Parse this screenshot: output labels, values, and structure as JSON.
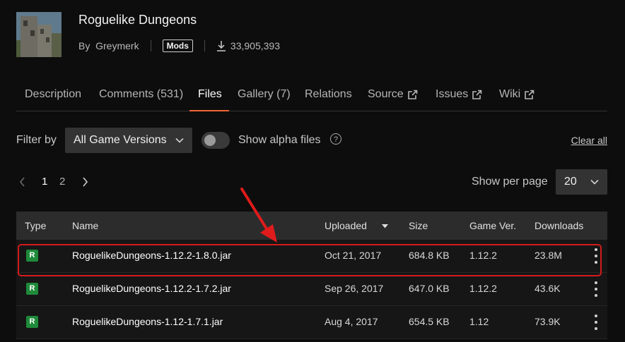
{
  "project": {
    "title": "Roguelike Dungeons",
    "author_prefix": "By",
    "author": "Greymerk",
    "category_badge": "Mods",
    "downloads": "33,905,393",
    "thumbnail_icon": "mod-thumbnail-icon"
  },
  "tabs": [
    {
      "label": "Description",
      "external": false
    },
    {
      "label": "Comments (531)",
      "external": false
    },
    {
      "label": "Files",
      "external": false,
      "active": true
    },
    {
      "label": "Gallery (7)",
      "external": false
    },
    {
      "label": "Relations",
      "external": false
    },
    {
      "label": "Source",
      "external": true
    },
    {
      "label": "Issues",
      "external": true
    },
    {
      "label": "Wiki",
      "external": true
    }
  ],
  "filters": {
    "filter_label": "Filter by",
    "game_version_selected": "All Game Versions",
    "alpha_toggle_label": "Show alpha files",
    "alpha_toggle_on": false,
    "clear_all": "Clear all"
  },
  "pagination": {
    "pages": [
      "1",
      "2"
    ],
    "current": "1",
    "per_page_label": "Show per page",
    "per_page_value": "20"
  },
  "table": {
    "columns": {
      "type": "Type",
      "name": "Name",
      "uploaded": "Uploaded",
      "size": "Size",
      "game_ver": "Game Ver.",
      "downloads": "Downloads"
    },
    "rows": [
      {
        "type": "R",
        "name": "RoguelikeDungeons-1.12.2-1.8.0.jar",
        "uploaded": "Oct 21, 2017",
        "size": "684.8 KB",
        "game_ver": "1.12.2",
        "downloads": "23.8M"
      },
      {
        "type": "R",
        "name": "RoguelikeDungeons-1.12.2-1.7.2.jar",
        "uploaded": "Sep 26, 2017",
        "size": "647.0 KB",
        "game_ver": "1.12.2",
        "downloads": "43.6K"
      },
      {
        "type": "R",
        "name": "RoguelikeDungeons-1.12-1.7.1.jar",
        "uploaded": "Aug 4, 2017",
        "size": "654.5 KB",
        "game_ver": "1.12",
        "downloads": "73.9K"
      }
    ]
  },
  "colors": {
    "accent": "#f16436",
    "release_badge": "#1e8a3a",
    "highlight_annotation": "#d31a1a"
  }
}
